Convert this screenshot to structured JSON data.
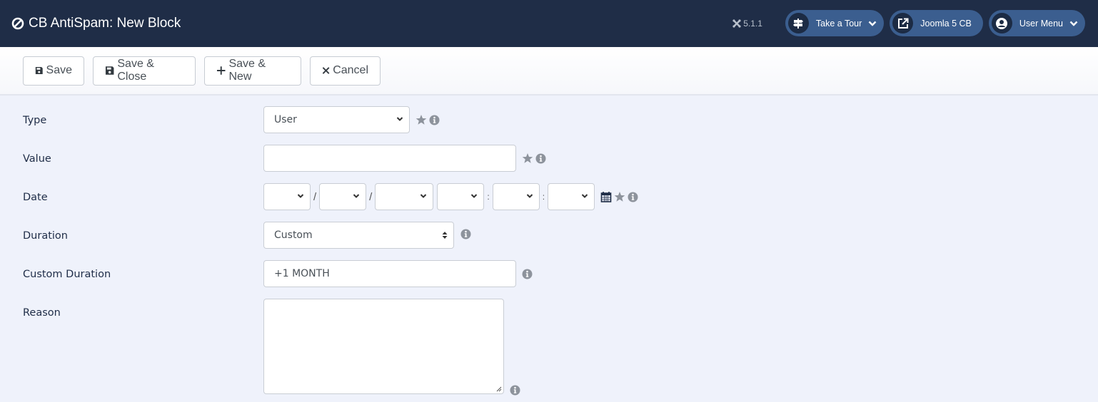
{
  "header": {
    "title": "CB AntiSpam: New Block",
    "title_icon": "ban-icon",
    "version": "5.1.1",
    "pills": [
      {
        "label": "Take a Tour",
        "icon": "signpost-icon",
        "has_dropdown": true
      },
      {
        "label": "Joomla 5 CB",
        "icon": "external-link-icon",
        "has_dropdown": false
      },
      {
        "label": "User Menu",
        "icon": "user-circle-icon",
        "has_dropdown": true
      }
    ]
  },
  "toolbar": {
    "save_label": "Save",
    "save_close_label": "Save & Close",
    "save_new_label": "Save & New",
    "cancel_label": "Cancel"
  },
  "form": {
    "type": {
      "label": "Type",
      "value": "User",
      "required": true
    },
    "value": {
      "label": "Value",
      "value": "",
      "required": true
    },
    "date": {
      "label": "Date",
      "separators": [
        "/",
        "/",
        "",
        ":",
        ":"
      ],
      "required": true
    },
    "duration": {
      "label": "Duration",
      "value": "Custom"
    },
    "custom_duration": {
      "label": "Custom Duration",
      "value": "+1 MONTH"
    },
    "reason": {
      "label": "Reason",
      "value": ""
    }
  },
  "colors": {
    "header_bg": "#1f2d47",
    "pill_bg": "#3b5e8f",
    "page_bg": "#eff2fb"
  }
}
